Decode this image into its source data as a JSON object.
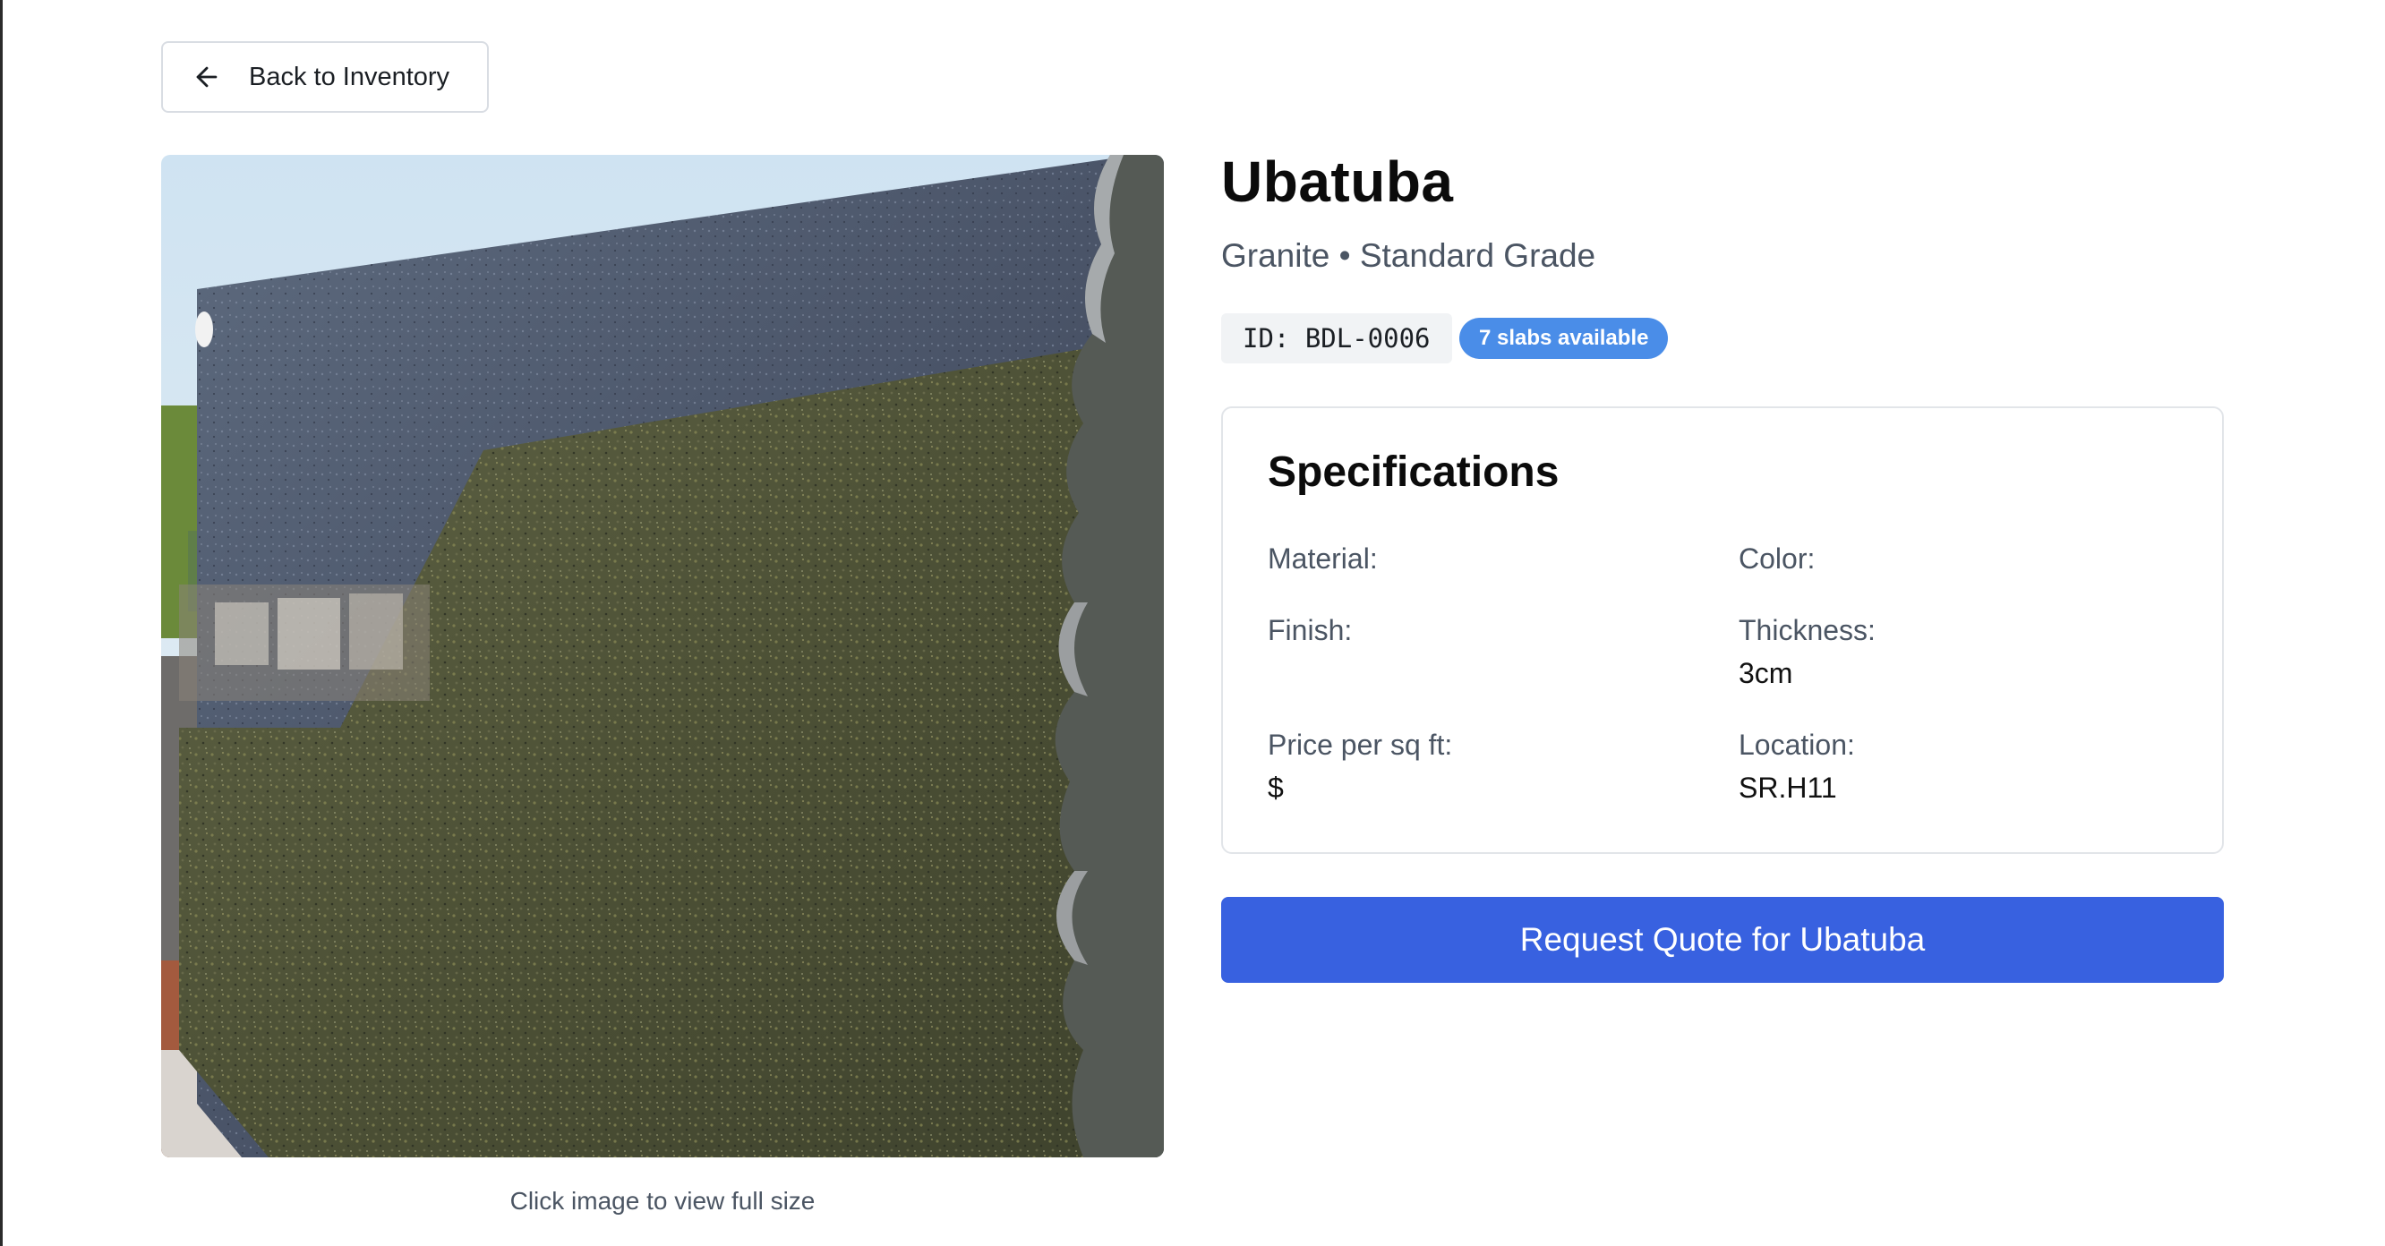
{
  "back_button": {
    "label": "Back to Inventory",
    "icon": "arrow-left-icon"
  },
  "product": {
    "name": "Ubatuba",
    "subtitle": "Granite • Standard Grade",
    "id_label": "ID: BDL-0006",
    "availability": "7 slabs available",
    "image_caption": "Click image to view full size"
  },
  "specifications": {
    "title": "Specifications",
    "material": {
      "label": "Material:",
      "value": ""
    },
    "color": {
      "label": "Color:",
      "value": ""
    },
    "finish": {
      "label": "Finish:",
      "value": ""
    },
    "thickness": {
      "label": "Thickness:",
      "value": "3cm"
    },
    "price": {
      "label": "Price per sq ft:",
      "value": "$"
    },
    "location": {
      "label": "Location:",
      "value": "SR.H11"
    }
  },
  "quote_button": {
    "label": "Request Quote for Ubatuba"
  },
  "colors": {
    "primary_button": "#3861e0",
    "badge": "#4a8de8",
    "muted_text": "#4b5563",
    "chip_background": "#f1f3f5"
  }
}
